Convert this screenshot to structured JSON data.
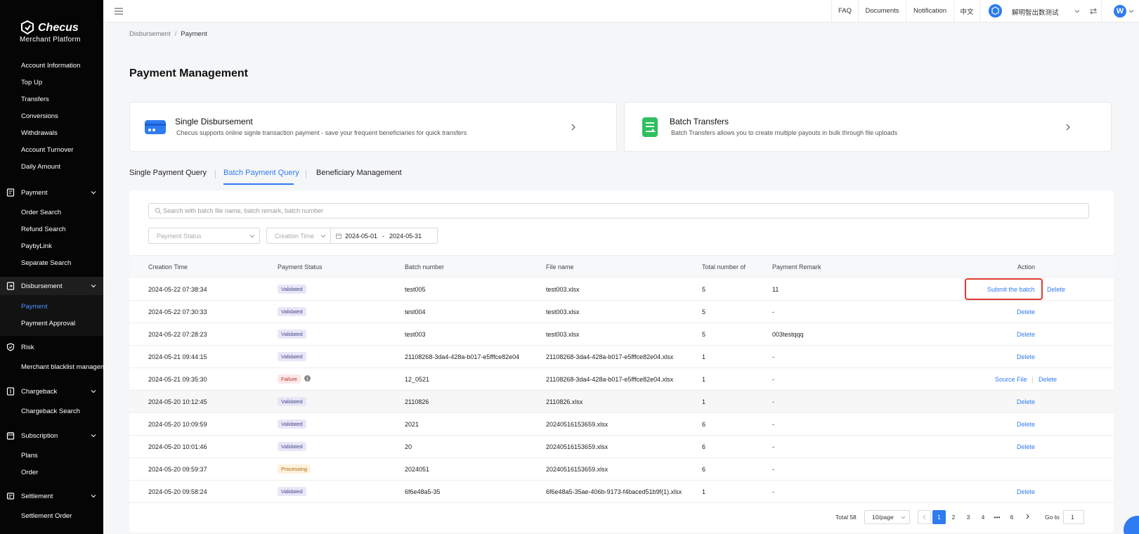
{
  "brand": {
    "name": "Checus",
    "sub": "Merchant  Platform"
  },
  "sidebar": {
    "items_top": [
      {
        "label": "Account Information"
      },
      {
        "label": "Top Up"
      },
      {
        "label": "Transfers"
      },
      {
        "label": "Conversions"
      },
      {
        "label": "Withdrawals"
      },
      {
        "label": "Account Turnover"
      },
      {
        "label": "Daily Amount"
      }
    ],
    "groups": [
      {
        "label": "Payment",
        "items": [
          "Order Search",
          "Refund Search",
          "PaybyLink",
          "Separate Search"
        ]
      },
      {
        "label": "Disbursement",
        "items": [
          "Payment",
          "Payment Approval"
        ]
      },
      {
        "label": "Risk",
        "items": [
          "Merchant blacklist management"
        ]
      },
      {
        "label": "Chargeback",
        "items": [
          "Chargeback Search"
        ]
      },
      {
        "label": "Subscription",
        "items": [
          "Plans",
          "Order"
        ]
      },
      {
        "label": "Settlement",
        "items": [
          "Settlement Order"
        ]
      }
    ]
  },
  "topbar": {
    "faq": "FAQ",
    "documents": "Documents",
    "notification": "Notification",
    "language": "中文",
    "user_name": "解明智出数测试",
    "avatar_letter": "W"
  },
  "breadcrumb": {
    "parent": "Disbursement",
    "sep": "/",
    "current": "Payment"
  },
  "page_title": "Payment Management",
  "cards": [
    {
      "title": "Single Disbursement",
      "desc": "Checus supports online signle transaction payment - save your frequent beneficiaries for quick transfers"
    },
    {
      "title": "Batch Transfers",
      "desc": "Batch Transfers allows you to create multiple payouts in bulk through file uploads"
    }
  ],
  "tabs": [
    "Single Payment Query",
    "Batch Payment Query",
    "Beneficiary Management"
  ],
  "filters": {
    "search_placeholder": "Search with batch file name, batch remark, batch number",
    "payment_status_placeholder": "Payment Status",
    "creation_time_placeholder": "Creation Time",
    "date_start": "2024-05-01",
    "date_sep": "-",
    "date_end": "2024-05-31"
  },
  "table": {
    "headers": [
      "Creation Time",
      "Payment Status",
      "Batch number",
      "File name",
      "Total number of",
      "Payment Remark",
      "Action"
    ],
    "rows": [
      {
        "time": "2024-05-22 07:38:34",
        "status": "Validated",
        "batch": "test005",
        "file": "test003.xlsx",
        "total": "5",
        "remark": "11",
        "actions": [
          "Submit the batch",
          "Delete"
        ]
      },
      {
        "time": "2024-05-22 07:30:33",
        "status": "Validated",
        "batch": "test004",
        "file": "test003.xlsx",
        "total": "5",
        "remark": "-",
        "actions": [
          "Delete"
        ]
      },
      {
        "time": "2024-05-22 07:28:23",
        "status": "Validated",
        "batch": "test003",
        "file": "test003.xlsx",
        "total": "5",
        "remark": "003testqqq",
        "actions": [
          "Delete"
        ]
      },
      {
        "time": "2024-05-21 09:44:15",
        "status": "Validated",
        "batch": "21108268-3da4-428a-b017-e5fffce82e04",
        "file": "21108268-3da4-428a-b017-e5fffce82e04.xlsx",
        "total": "1",
        "remark": "-",
        "actions": [
          "Delete"
        ]
      },
      {
        "time": "2024-05-21 09:35:30",
        "status": "Failure",
        "batch": "12_0521",
        "file": "21108268-3da4-428a-b017-e5fffce82e04.xlsx",
        "total": "1",
        "remark": "-",
        "actions": [
          "Source File",
          "Delete"
        ]
      },
      {
        "time": "2024-05-20 10:12:45",
        "status": "Validated",
        "batch": "2110826",
        "file": "2110826.xlsx",
        "total": "1",
        "remark": "-",
        "actions": [
          "Delete"
        ]
      },
      {
        "time": "2024-05-20 10:09:59",
        "status": "Validated",
        "batch": "2021",
        "file": "20240516153659.xlsx",
        "total": "6",
        "remark": "-",
        "actions": [
          "Delete"
        ]
      },
      {
        "time": "2024-05-20 10:01:46",
        "status": "Validated",
        "batch": "20",
        "file": "20240516153659.xlsx",
        "total": "6",
        "remark": "-",
        "actions": [
          "Delete"
        ]
      },
      {
        "time": "2024-05-20 09:59:37",
        "status": "Processing",
        "batch": "2024051",
        "file": "20240516153659.xlsx",
        "total": "6",
        "remark": "-",
        "actions": []
      },
      {
        "time": "2024-05-20 09:58:24",
        "status": "Validated",
        "batch": "6f6e48a5-35",
        "file": "6f6e48a5-35ae-406b-9173-f4baced51b9f(1).xlsx",
        "total": "1",
        "remark": "-",
        "actions": [
          "Delete"
        ]
      }
    ]
  },
  "pagination": {
    "total": "Total 58",
    "page_size": "10/page",
    "pages": [
      "1",
      "2",
      "3",
      "4",
      "•••",
      "6"
    ],
    "current": "1",
    "goto_label": "Go to",
    "goto_value": "1"
  },
  "colors": {
    "accent": "#2f7bf1",
    "highlight": "#e03a2f",
    "sidebar": "#050505"
  }
}
